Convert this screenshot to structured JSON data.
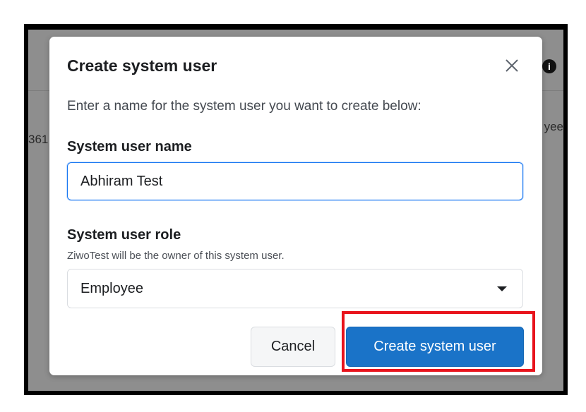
{
  "background": {
    "left_fragment": "361",
    "right_fragment": "yee",
    "info_icon": "info-icon"
  },
  "dialog": {
    "title": "Create system user",
    "close_icon": "close-icon",
    "intro": "Enter a name for the system user you want to create below:",
    "name_field": {
      "label": "System user name",
      "value": "Abhiram Test",
      "focused": true
    },
    "role_field": {
      "label": "System user role",
      "helper": "ZiwoTest will be the owner of this system user.",
      "selected": "Employee",
      "icon": "caret-down-icon"
    },
    "buttons": {
      "cancel": "Cancel",
      "create": "Create system user"
    }
  },
  "colors": {
    "primary": "#1a73c8",
    "focus_border": "#1877f2",
    "highlight": "#e8131c",
    "overlay": "#8e8e8e"
  }
}
